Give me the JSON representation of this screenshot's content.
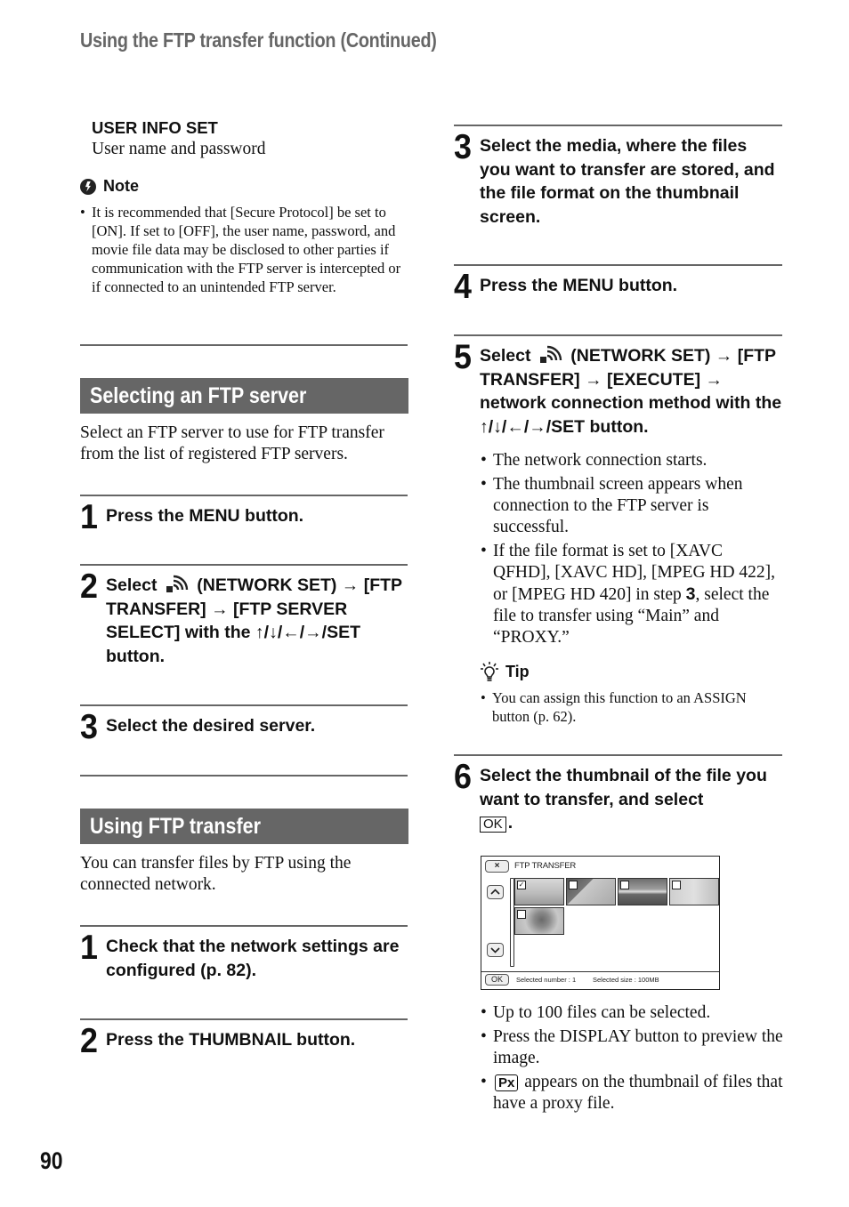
{
  "running_head": "Using the FTP transfer function (Continued)",
  "page_number": "90",
  "left_column": {
    "user_info": {
      "term": "USER INFO SET",
      "description": "User name and password"
    },
    "note": {
      "label": "Note",
      "icon": "note-caution-icon",
      "items": [
        "It is recommended that [Secure Protocol] be set to [ON]. If set to [OFF], the user name, password, and movie file data may be disclosed to other parties if communication with the FTP server is intercepted or if connected to an unintended FTP server."
      ]
    },
    "section_select_server": {
      "title": "Selecting an FTP server",
      "intro": "Select an FTP server to use for FTP transfer from the list of registered FTP servers.",
      "steps": [
        {
          "num": "1",
          "text": "Press the MENU button."
        },
        {
          "num": "2",
          "pre": "Select",
          "icon": "network-set-icon",
          "post": "(NETWORK SET) → [FTP TRANSFER] → [FTP SERVER SELECT] with the ↑/↓/←/→/SET button."
        },
        {
          "num": "3",
          "text": "Select the desired server."
        }
      ]
    },
    "section_using_ftp": {
      "title": "Using FTP transfer",
      "intro": "You can transfer files by FTP using the connected network.",
      "steps": [
        {
          "num": "1",
          "text": "Check that the network settings are configured (p. 82)."
        },
        {
          "num": "2",
          "text": "Press the THUMBNAIL button."
        }
      ]
    }
  },
  "right_column": {
    "steps": [
      {
        "num": "3",
        "text": "Select the media, where the files you want to transfer are stored, and the file format on the thumbnail screen."
      },
      {
        "num": "4",
        "text": "Press the MENU button."
      },
      {
        "num": "5",
        "pre": "Select",
        "icon": "network-set-icon",
        "post": "(NETWORK SET) → [FTP TRANSFER] → [EXECUTE] → network connection method with the ↑/↓/←/→/SET button.",
        "bullets": [
          "The network connection starts.",
          "The thumbnail screen appears when connection to the FTP server is successful."
        ],
        "bullet3_pre": "If the file format is set to [XAVC QFHD], [XAVC HD], [MPEG HD 422], or [MPEG HD 420] in step ",
        "bullet3_bold": "3",
        "bullet3_post": ", select the file to transfer using “Main” and “PROXY.”"
      },
      {
        "num": "6",
        "text": "Select the thumbnail of the file you want to transfer, and select",
        "ok_label": "OK",
        "suffix": "."
      }
    ],
    "tip": {
      "label": "Tip",
      "icon": "tip-lightbulb-icon",
      "items": [
        "You can assign this function to an ASSIGN button (p. 62)."
      ]
    },
    "screen": {
      "title": "FTP TRANSFER",
      "close_label": "×",
      "up_label": "^",
      "down_label": "v",
      "ok_label": "OK",
      "selected_number": "Selected number : 1",
      "selected_size": "Selected size : 100MB",
      "thumbnails": [
        {
          "scene": "bright room interior",
          "checked": true
        },
        {
          "scene": "staircase",
          "checked": false
        },
        {
          "scene": "sunset over sea",
          "checked": false
        },
        {
          "scene": "person on beach",
          "checked": false
        },
        {
          "scene": "woman portrait",
          "checked": false
        }
      ]
    },
    "after_screen_bullets": [
      "Up to 100 files can be selected.",
      "Press the DISPLAY button to preview the image."
    ],
    "proxy_bullet": {
      "badge": "Px",
      "text": "appears on the thumbnail of files that have a proxy file."
    }
  }
}
